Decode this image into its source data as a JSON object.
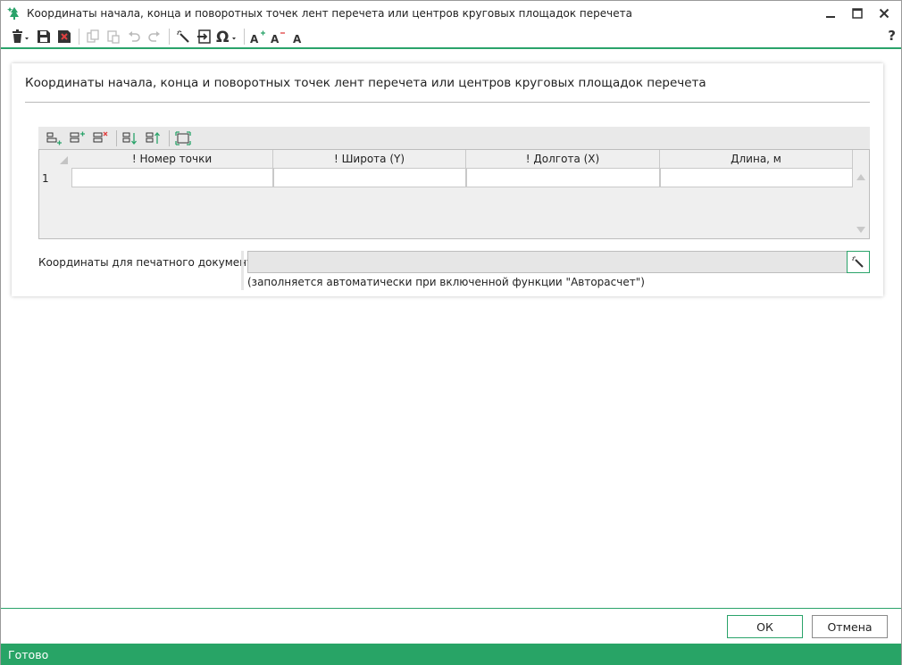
{
  "window": {
    "title": "Координаты начала, конца и поворотных точек лент перечета или центров круговых площадок перечета"
  },
  "toolbar": {
    "icons": [
      "trash-icon",
      "save-icon",
      "close-doc-icon",
      "copy-icon",
      "paste-icon",
      "undo-icon",
      "redo-icon",
      "magic-wand-icon",
      "import-icon",
      "omega-icon",
      "font-increase-icon",
      "font-decrease-icon",
      "font-reset-icon"
    ],
    "help_label": "?"
  },
  "panel": {
    "title": "Координаты начала, конца и поворотных точек лент перечета или центров круговых площадок перечета"
  },
  "grid": {
    "toolbar_icons": [
      "add-row-icon",
      "insert-row-icon",
      "delete-row-icon",
      "move-down-icon",
      "move-up-icon",
      "fit-icon"
    ],
    "columns": [
      "! Номер точки",
      "! Широта (Y)",
      "! Долгота (X)",
      "Длина, м"
    ],
    "rows": [
      {
        "num": "1",
        "cells": [
          "",
          "",
          "",
          ""
        ]
      }
    ]
  },
  "print_field": {
    "label": "Координаты для печатного документа",
    "value": "",
    "hint": "(заполняется автоматически при включенной функции \"Авторасчет\")"
  },
  "buttons": {
    "ok": "ОК",
    "cancel": "Отмена"
  },
  "status": {
    "text": "Готово"
  },
  "colors": {
    "accent": "#2aa36a",
    "status_bg": "#28a466"
  }
}
